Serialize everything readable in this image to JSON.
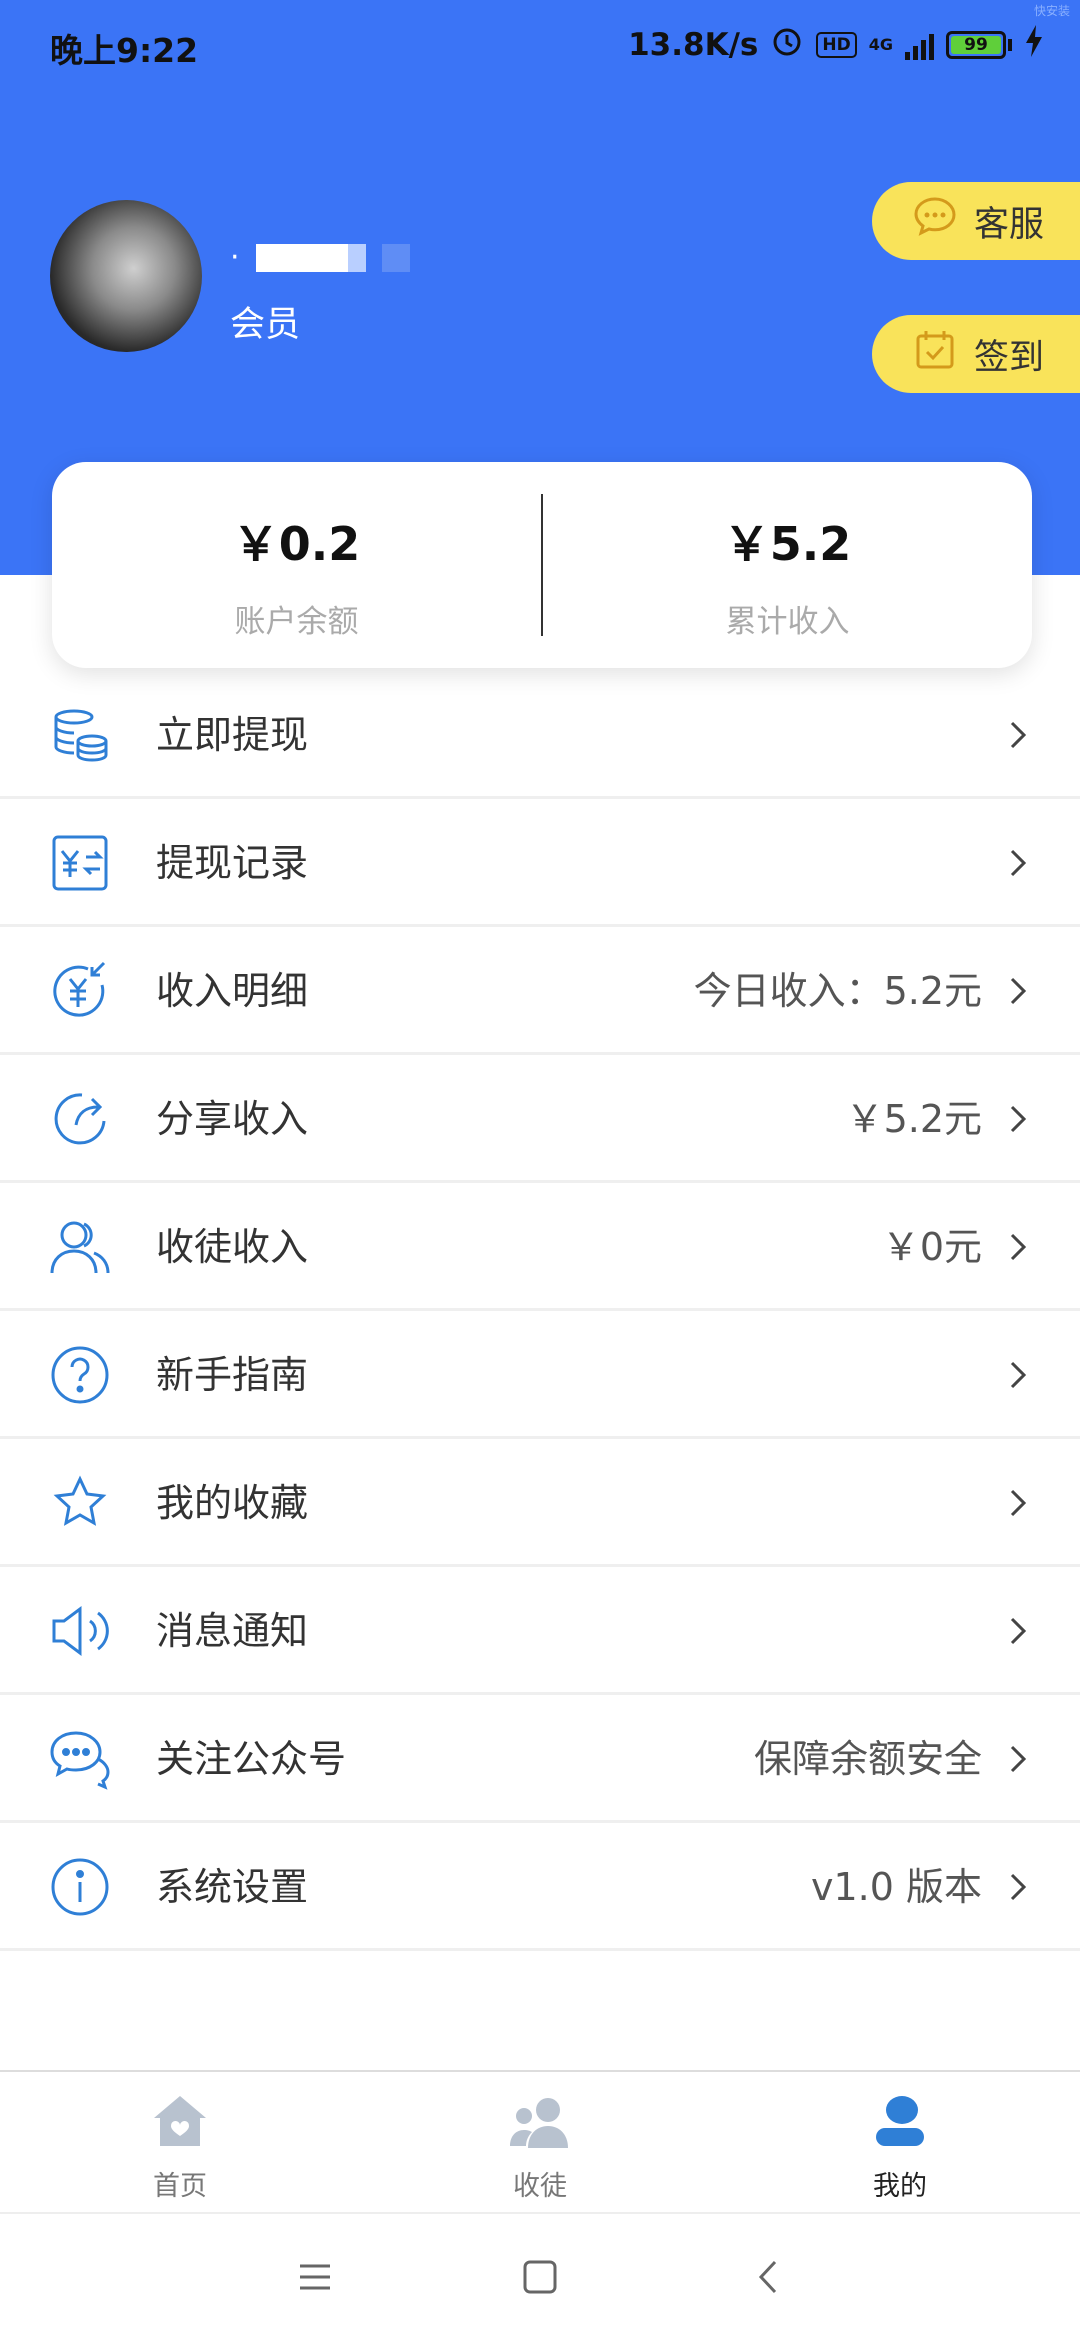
{
  "status_bar": {
    "time": "晚上9:22",
    "net_speed": "13.8K/s",
    "hd_badge": "HD",
    "network": "4G",
    "battery": "99",
    "watermark": "快安装"
  },
  "profile": {
    "name_prefix": "·",
    "member_label": "会员"
  },
  "actions": {
    "service_label": "客服",
    "checkin_label": "签到"
  },
  "balance": {
    "account_value": "￥0.2",
    "account_label": "账户余额",
    "total_value": "￥5.2",
    "total_label": "累计收入"
  },
  "menu": [
    {
      "icon": "coins-icon",
      "label": "立即提现",
      "value": ""
    },
    {
      "icon": "withdraw-record-icon",
      "label": "提现记录",
      "value": ""
    },
    {
      "icon": "income-detail-icon",
      "label": "收入明细",
      "value": "今日收入：5.2元"
    },
    {
      "icon": "share-refresh-icon",
      "label": "分享收入",
      "value": "￥5.2元"
    },
    {
      "icon": "users-icon",
      "label": "收徒收入",
      "value": "￥0元"
    },
    {
      "icon": "question-icon",
      "label": "新手指南",
      "value": ""
    },
    {
      "icon": "star-icon",
      "label": "我的收藏",
      "value": ""
    },
    {
      "icon": "speaker-icon",
      "label": "消息通知",
      "value": ""
    },
    {
      "icon": "chat-icon",
      "label": "关注公众号",
      "value": "保障余额安全"
    },
    {
      "icon": "info-icon",
      "label": "系统设置",
      "value": "v1.0 版本"
    }
  ],
  "tabs": [
    {
      "label": "首页",
      "icon": "home-icon"
    },
    {
      "label": "收徒",
      "icon": "group-icon"
    },
    {
      "label": "我的",
      "icon": "person-icon"
    }
  ],
  "colors": {
    "brand_blue": "#3b74f6",
    "accent_yellow": "#f9e35a",
    "icon_blue": "#2f7fd6"
  }
}
